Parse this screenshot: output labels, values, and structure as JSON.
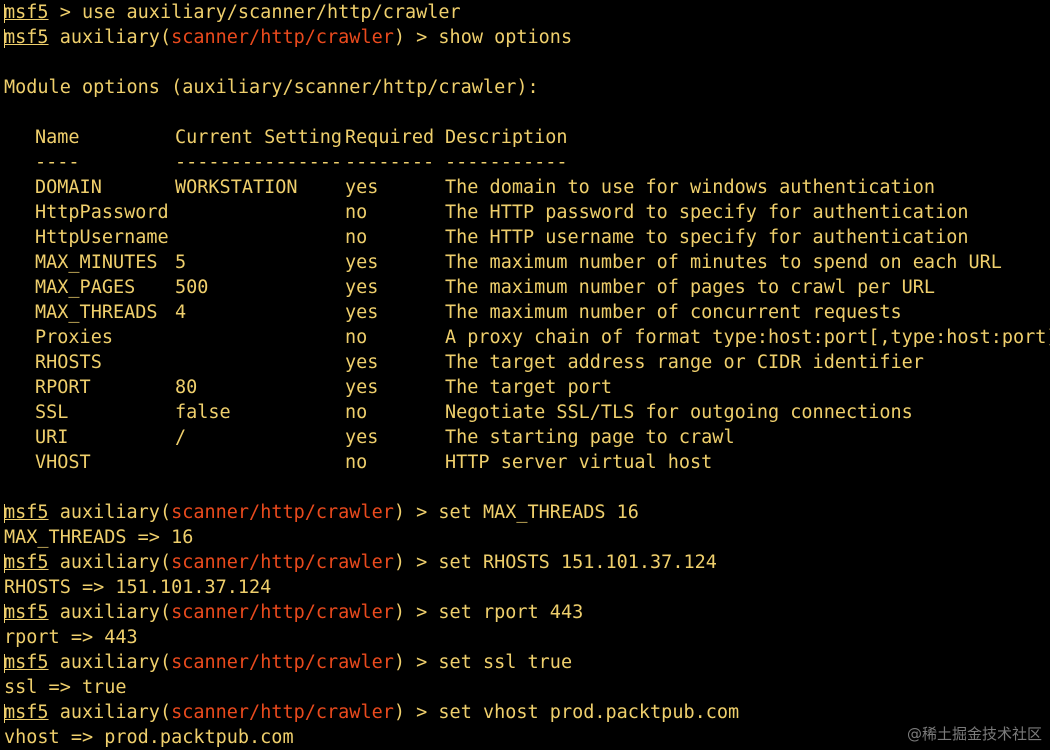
{
  "prompt": {
    "name": "msf5",
    "context": "auxiliary",
    "module": "scanner/http/crawler",
    "suffix": "> "
  },
  "line1": {
    "text": "msf5 > use auxiliary/scanner/http/crawler"
  },
  "cmd_show": "show options",
  "module_header": "Module options (auxiliary/scanner/http/crawler):",
  "table": {
    "headers": [
      "Name",
      "Current Setting",
      "Required",
      "Description"
    ],
    "dashes": [
      "----",
      "---------------",
      "--------",
      "-----------"
    ],
    "rows": [
      {
        "name": "DOMAIN",
        "setting": "WORKSTATION",
        "required": "yes",
        "description": "The domain to use for windows authentication"
      },
      {
        "name": "HttpPassword",
        "setting": "",
        "required": "no",
        "description": "The HTTP password to specify for authentication"
      },
      {
        "name": "HttpUsername",
        "setting": "",
        "required": "no",
        "description": "The HTTP username to specify for authentication"
      },
      {
        "name": "MAX_MINUTES",
        "setting": "5",
        "required": "yes",
        "description": "The maximum number of minutes to spend on each URL"
      },
      {
        "name": "MAX_PAGES",
        "setting": "500",
        "required": "yes",
        "description": "The maximum number of pages to crawl per URL"
      },
      {
        "name": "MAX_THREADS",
        "setting": "4",
        "required": "yes",
        "description": "The maximum number of concurrent requests"
      },
      {
        "name": "Proxies",
        "setting": "",
        "required": "no",
        "description": "A proxy chain of format type:host:port[,type:host:port][...]"
      },
      {
        "name": "RHOSTS",
        "setting": "",
        "required": "yes",
        "description": "The target address range or CIDR identifier"
      },
      {
        "name": "RPORT",
        "setting": "80",
        "required": "yes",
        "description": "The target port"
      },
      {
        "name": "SSL",
        "setting": "false",
        "required": "no",
        "description": "Negotiate SSL/TLS for outgoing connections"
      },
      {
        "name": "URI",
        "setting": "/",
        "required": "yes",
        "description": "The starting page to crawl"
      },
      {
        "name": "VHOST",
        "setting": "",
        "required": "no",
        "description": "HTTP server virtual host"
      }
    ]
  },
  "commands": [
    {
      "cmd": "set MAX_THREADS 16",
      "output": "MAX_THREADS => 16"
    },
    {
      "cmd": "set RHOSTS 151.101.37.124",
      "output": "RHOSTS => 151.101.37.124"
    },
    {
      "cmd": "set rport 443",
      "output": "rport => 443"
    },
    {
      "cmd": "set ssl true",
      "output": "ssl => true"
    },
    {
      "cmd": "set vhost prod.packtpub.com",
      "output": "vhost => prod.packtpub.com"
    }
  ],
  "watermark": "@稀土掘金技术社区",
  "colors": {
    "background": "#000000",
    "text": "#efcf6c",
    "module": "#ea4a1d"
  }
}
